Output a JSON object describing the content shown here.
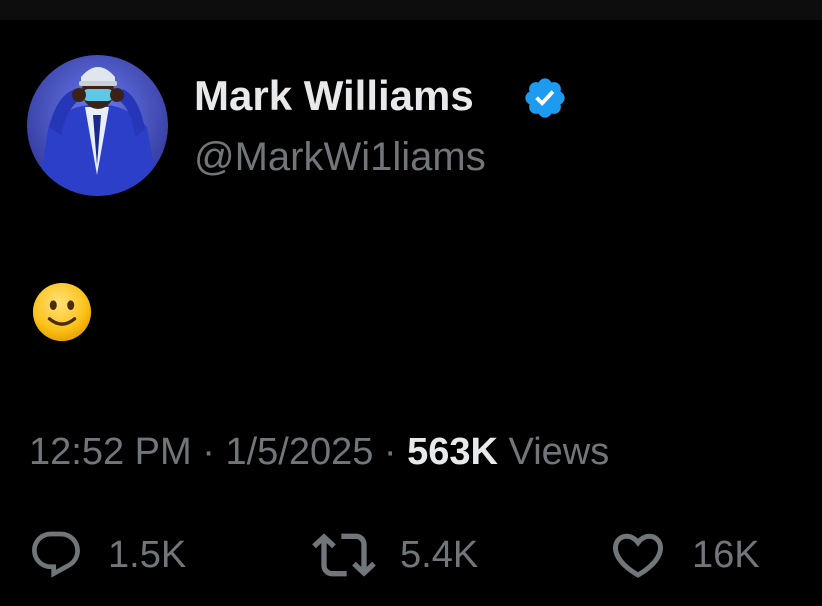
{
  "profile": {
    "display_name": "Mark Williams",
    "handle": "@MarkWi1liams",
    "verified": true,
    "avatar_icon": "profile-photo",
    "verified_icon": "verified-badge-icon"
  },
  "tweet": {
    "emoji": "🙂",
    "time": "12:52 PM",
    "separator": "·",
    "date": "1/5/2025",
    "views_count": "563K",
    "views_label": "Views"
  },
  "actions": {
    "reply": {
      "icon": "reply-icon",
      "count": "1.5K"
    },
    "retweet": {
      "icon": "retweet-icon",
      "count": "5.4K"
    },
    "like": {
      "icon": "heart-icon",
      "count": "16K"
    }
  },
  "colors": {
    "background": "#000000",
    "primary_text": "#e7e9ea",
    "secondary_text": "#71767b",
    "verified_blue": "#1d9bf0",
    "avatar_bg": "#3a45b8"
  }
}
